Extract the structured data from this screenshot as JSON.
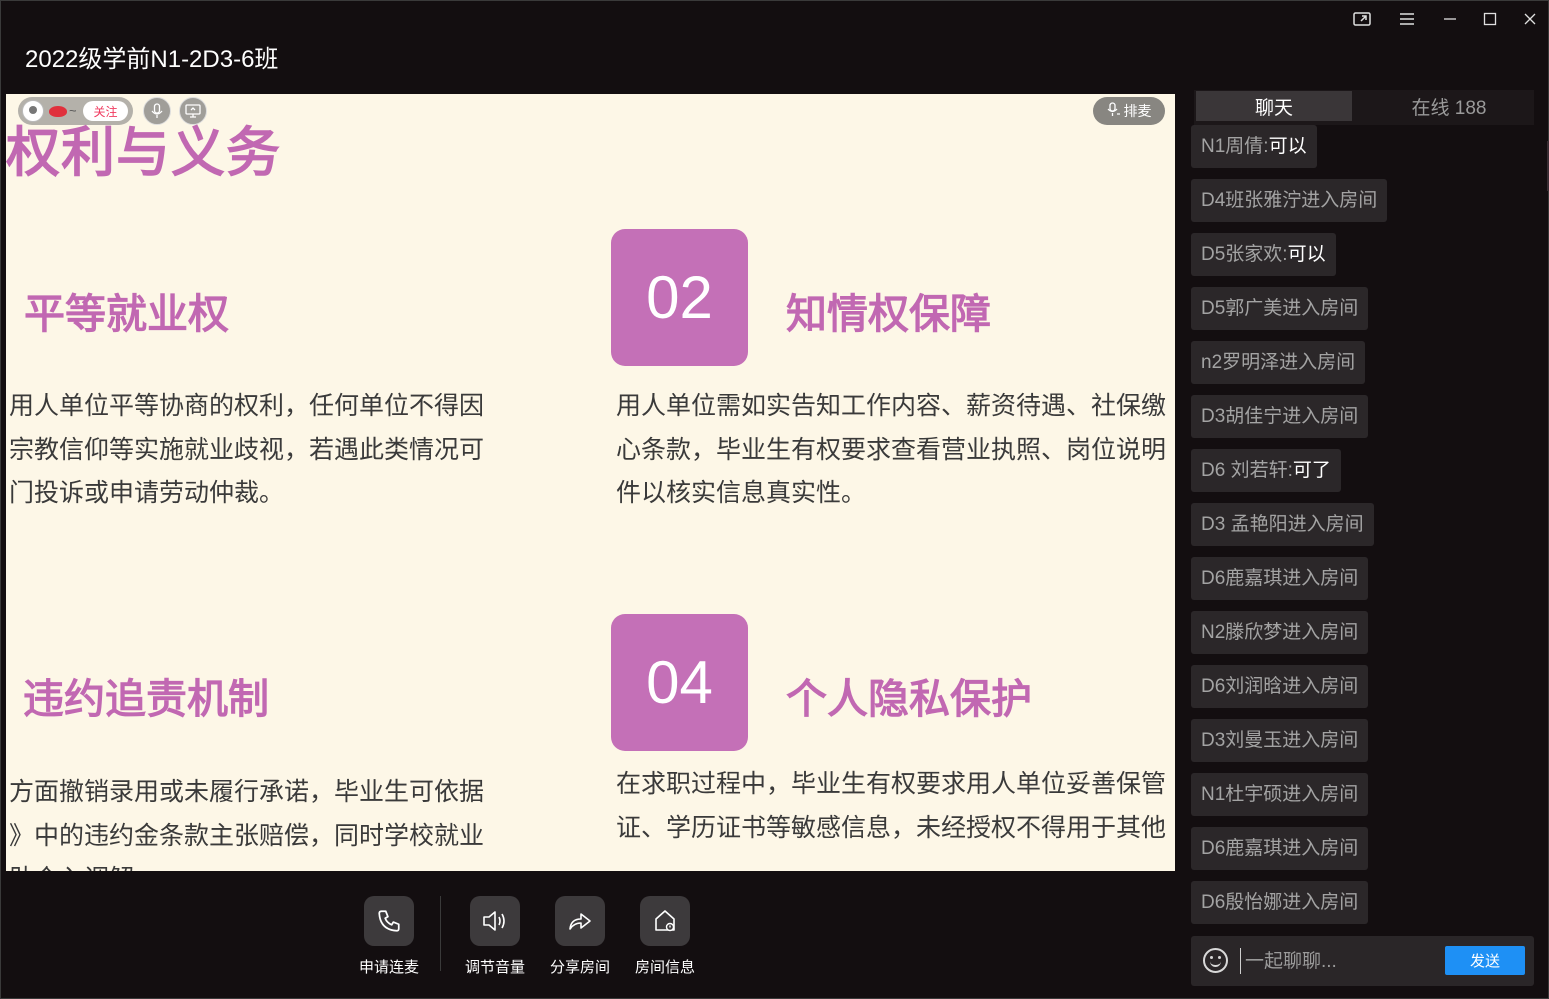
{
  "window": {
    "title": "2022级学前N1-2D3-6班"
  },
  "window_controls": {
    "pip_icon": "picture-in-picture-icon",
    "menu_icon": "hamburger-menu-icon",
    "minimize_icon": "minimize-icon",
    "maximize_icon": "maximize-icon",
    "close_icon": "close-icon"
  },
  "stage_overlay": {
    "follow_label": "关注",
    "tilde": "~",
    "queue_label": "排麦"
  },
  "slide": {
    "title": "权利与义务",
    "sections": [
      {
        "heading": "平等就业权",
        "text": "用人单位平等协商的权利，任何单位不得因\n宗教信仰等实施就业歧视，若遇此类情况可\n门投诉或申请劳动仲裁。"
      },
      {
        "number": "02",
        "heading": "知情权保障",
        "text": "用人单位需如实告知工作内容、薪资待遇、社保缴\n心条款，毕业生有权要求查看营业执照、岗位说明\n件以核实信息真实性。"
      },
      {
        "heading": "违约追责机制",
        "text": "方面撤销录用或未履行承诺，毕业生可依据\n》中的违约金条款主张赔偿，同时学校就业\n助介入调解。"
      },
      {
        "number": "04",
        "heading": "个人隐私保护",
        "text": "在求职过程中，毕业生有权要求用人单位妥善保管\n证、学历证书等敏感信息，未经授权不得用于其他"
      }
    ]
  },
  "toolbar": {
    "items": [
      {
        "label": "申请连麦",
        "icon": "phone-icon"
      },
      {
        "label": "调节音量",
        "icon": "speaker-icon"
      },
      {
        "label": "分享房间",
        "icon": "share-icon"
      },
      {
        "label": "房间信息",
        "icon": "house-info-icon"
      }
    ]
  },
  "chat_panel": {
    "tab_chat": "聊天",
    "tab_online": "在线 188",
    "messages": [
      {
        "user": "N1周倩:",
        "text": "可以",
        "type": "chat"
      },
      {
        "user": "D4班张雅泞",
        "text": "进入房间",
        "type": "system"
      },
      {
        "user": "D5张家欢:",
        "text": "可以",
        "type": "chat"
      },
      {
        "user": "D5郭广美",
        "text": "进入房间",
        "type": "system"
      },
      {
        "user": "n2罗明泽",
        "text": "进入房间",
        "type": "system"
      },
      {
        "user": "D3胡佳宁",
        "text": "进入房间",
        "type": "system"
      },
      {
        "user": "D6 刘若轩:",
        "text": "可了",
        "type": "chat"
      },
      {
        "user": "D3 孟艳阳",
        "text": "进入房间",
        "type": "system"
      },
      {
        "user": "D6鹿嘉琪",
        "text": "进入房间",
        "type": "system"
      },
      {
        "user": "N2滕欣梦",
        "text": "进入房间",
        "type": "system"
      },
      {
        "user": "D6刘润晗",
        "text": "进入房间",
        "type": "system"
      },
      {
        "user": "D3刘曼玉",
        "text": "进入房间",
        "type": "system"
      },
      {
        "user": "N1杜宇硕",
        "text": "进入房间",
        "type": "system"
      },
      {
        "user": "D6鹿嘉琪",
        "text": "进入房间",
        "type": "system"
      },
      {
        "user": "D6殷怡娜",
        "text": "进入房间",
        "type": "system"
      }
    ],
    "input_placeholder": "一起聊聊...",
    "send_label": "发送"
  },
  "colors": {
    "slide_background": "#fdf7e7",
    "accent_purple": "#c168b2",
    "send_button": "#1e90f5",
    "window_background": "#130e10"
  }
}
